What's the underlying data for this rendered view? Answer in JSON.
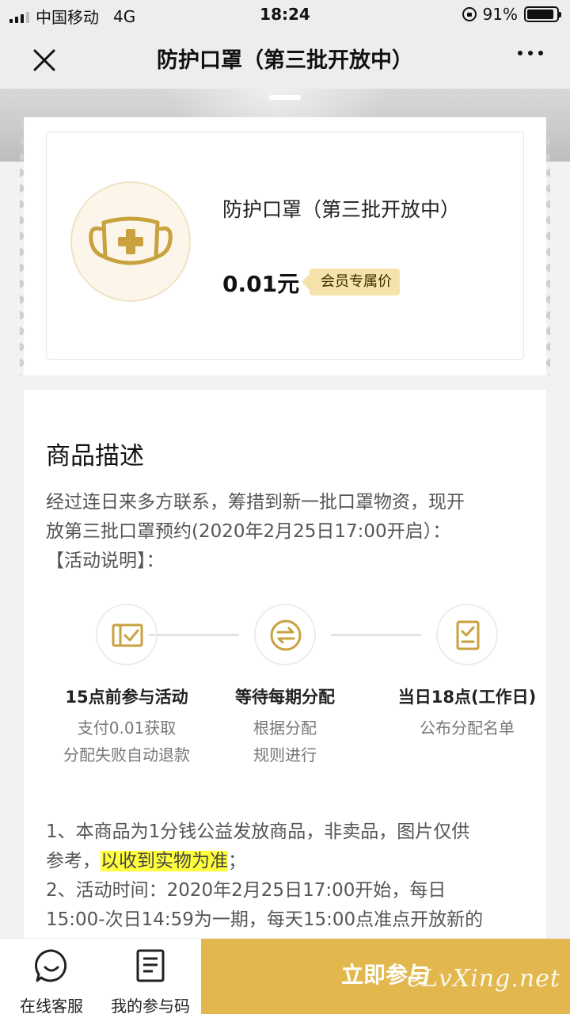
{
  "status": {
    "carrier": "中国移动",
    "network": "4G",
    "time": "18:24",
    "battery": "91%",
    "battery_level": 0.91
  },
  "nav": {
    "title": "防护口罩（第三批开放中）"
  },
  "product": {
    "name": "防护口罩（第三批开放中）",
    "price": "0.01元",
    "tag": "会员专属价"
  },
  "description": {
    "heading": "商品描述",
    "intro_1": "经过连日来多方联系，筹措到新一批口罩物资，现开",
    "intro_2": "放第三批口罩预约(2020年2月25日17:00开启）：",
    "intro_3": "【活动说明】：",
    "steps": [
      {
        "title": "15点前参与活动",
        "line1": "支付0.01获取",
        "line2": "分配失败自动退款"
      },
      {
        "title": "等待每期分配",
        "line1": "根据分配",
        "line2": "规则进行"
      },
      {
        "title": "当日18点(工作日)",
        "line1": "公布分配名单",
        "line2": ""
      }
    ],
    "rule_1a": "1、本商品为1分钱公益发放商品，非卖品，图片仅供",
    "rule_1b": "参考，",
    "rule_1c": "以收到实物为准",
    "rule_1d": "；",
    "rule_2a": "2、活动时间：2020年2月25日17:00开始，每日",
    "rule_2b": "15:00-次日14:59为一期，每天15:00点准点开放新的"
  },
  "bottom": {
    "service": "在线客服",
    "code": "我的参与码",
    "join": "立即参与"
  },
  "watermark": "eLvXing.net",
  "colors": {
    "accent": "#e2b84e",
    "icon": "#c9a23f",
    "highlight": "#ffff3b"
  }
}
